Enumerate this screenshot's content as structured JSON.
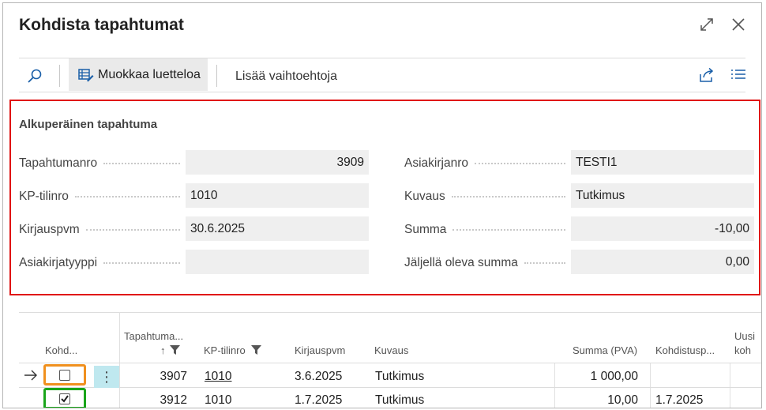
{
  "dialog": {
    "title": "Kohdista tapahtumat"
  },
  "toolbar": {
    "edit_list_label": "Muokkaa luetteloa",
    "more_options_label": "Lisää vaihtoehtoja"
  },
  "original_entry": {
    "section_title": "Alkuperäinen tapahtuma",
    "left_fields": [
      {
        "label": "Tapahtumanro",
        "value": "3909"
      },
      {
        "label": "KP-tilinro",
        "value": "1010"
      },
      {
        "label": "Kirjauspvm",
        "value": "30.6.2025"
      },
      {
        "label": "Asiakirjatyyppi",
        "value": ""
      }
    ],
    "right_fields": [
      {
        "label": "Asiakirjanro",
        "value": "TESTI1"
      },
      {
        "label": "Kuvaus",
        "value": "Tutkimus"
      },
      {
        "label": "Summa",
        "value": "-10,00"
      },
      {
        "label": "Jäljellä oleva summa",
        "value": "0,00"
      }
    ]
  },
  "grid": {
    "headers": {
      "apply": "Kohd...",
      "entry_no_line1": "Tapahtuma...",
      "entry_no_sort": "↑",
      "gl_account": "KP-tilinro",
      "posting_date": "Kirjauspvm",
      "description": "Kuvaus",
      "amount": "Summa (PVA)",
      "applied_date": "Kohdistusp...",
      "new_line1": "Uusi",
      "new_line2": "koh"
    },
    "rows": [
      {
        "indicator": "→",
        "checked": false,
        "entry_no": "3907",
        "gl_account": "1010",
        "posting_date": "3.6.2025",
        "description": "Tutkimus",
        "amount": "1 000,00",
        "applied_date": ""
      },
      {
        "indicator": "",
        "checked": true,
        "entry_no": "3912",
        "gl_account": "1010",
        "posting_date": "1.7.2025",
        "description": "Tutkimus",
        "amount": "10,00",
        "applied_date": "1.7.2025"
      }
    ],
    "row_menu_glyph": "⋮"
  },
  "colors": {
    "highlight_red": "#e01010",
    "highlight_orange": "#f0901e",
    "highlight_green": "#1aa51a",
    "accent_blue": "#1a5fa8",
    "row_menu_bg": "#bfe8ef"
  }
}
